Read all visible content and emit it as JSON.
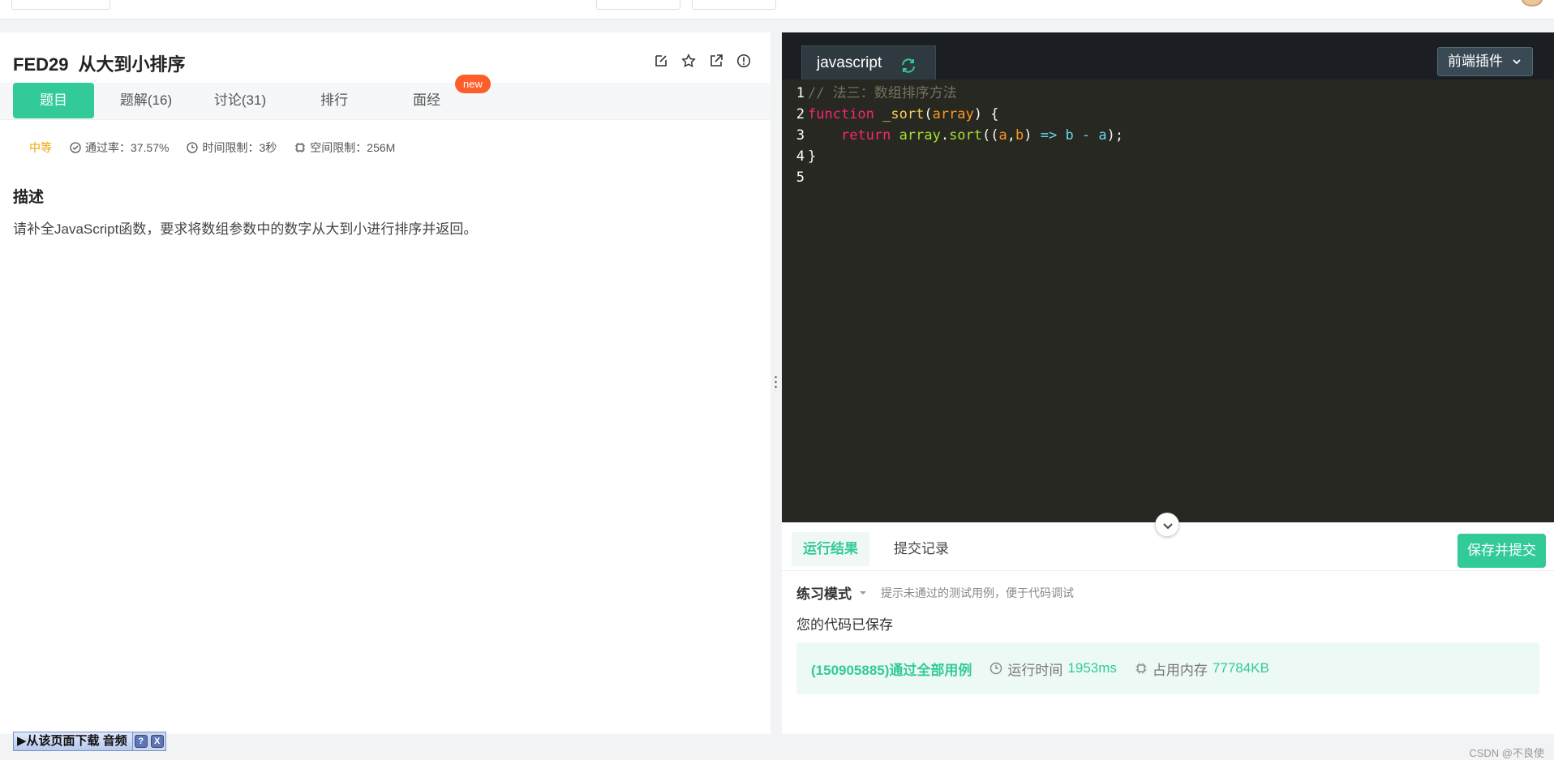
{
  "question": {
    "code": "FED29",
    "title": "从大到小排序",
    "tabs": [
      "题目",
      "题解(16)",
      "讨论(31)",
      "排行",
      "面经"
    ],
    "new_badge": "new",
    "level": "中等",
    "pass_rate": "通过率：37.57%",
    "time_limit": "时间限制：3秒",
    "space_limit": "空间限制：256M",
    "desc_heading": "描述",
    "desc_text": "请补全JavaScript函数，要求将数组参数中的数字从大到小进行排序并返回。"
  },
  "download_bar": {
    "label": "▶从该页面下载 音频",
    "help": "?",
    "close": "X"
  },
  "editor": {
    "language": "javascript",
    "plugin_label": "前端插件",
    "line_numbers": [
      "1",
      "2",
      "3",
      "4",
      "5"
    ],
    "line1_comment": "// 法三：数组排序方法",
    "line2_kw": "function",
    "line2_fn": "_sort",
    "line2_open": "(",
    "line2_param": "array",
    "line2_close": ") {",
    "line3_indent": "    ",
    "line3_kw": "return",
    "line3_var": "array",
    "line3_dot": ".",
    "line3_fn": "sort",
    "line3_p1": "((",
    "line3_a": "a",
    "line3_comma": ",",
    "line3_b": "b",
    "line3_p2": ") ",
    "line3_arrow": "=>",
    "line3_expr": " b - a",
    "line3_end": ");",
    "line4": "}"
  },
  "results": {
    "tab_result": "运行结果",
    "tab_history": "提交记录",
    "submit": "保存并提交",
    "mode": "练习模式",
    "mode_hint": "提示未通过的测试用例，便于代码调试",
    "saved": "您的代码已保存",
    "pass": "(150905885)通过全部用例",
    "runtime_label": "运行时间",
    "runtime_value": "1953ms",
    "memory_label": "占用内存",
    "memory_value": "77784KB"
  },
  "watermark": "CSDN @不良使",
  "colors": {
    "accent": "#32ca99",
    "badge": "#fe5e2a",
    "level": "#f0a000",
    "editor_bg": "#272822"
  }
}
